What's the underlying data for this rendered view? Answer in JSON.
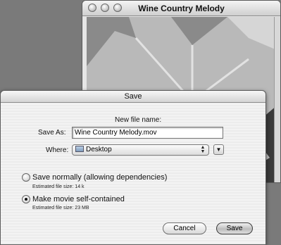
{
  "background_window": {
    "title": "Wine Country Melody"
  },
  "sheet": {
    "title": "Save",
    "new_file_name_label": "New file name:",
    "save_as_label": "Save As:",
    "save_as_value": "Wine Country Melody.mov",
    "where_label": "Where:",
    "where_value": "Desktop",
    "options": [
      {
        "label": "Save normally (allowing dependencies)",
        "estimate": "Estimated file size: 14 k",
        "selected": false
      },
      {
        "label": "Make movie self-contained",
        "estimate": "Estimated file size: 23 MB",
        "selected": true
      }
    ],
    "cancel_label": "Cancel",
    "save_label": "Save"
  }
}
